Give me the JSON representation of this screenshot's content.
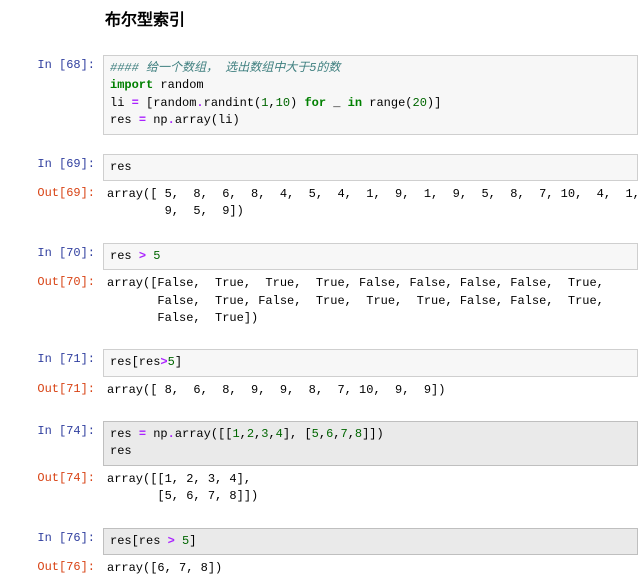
{
  "heading": "布尔型索引",
  "cells": [
    {
      "prompt": "In [68]:",
      "ptype": "in",
      "kind": "code",
      "tokens": [
        {
          "t": "#### 给一个数组， 选出数组中大于5的数",
          "c": "c-comment"
        },
        {
          "t": "\n"
        },
        {
          "t": "import",
          "c": "c-keyword"
        },
        {
          "t": " random\n"
        },
        {
          "t": "li "
        },
        {
          "t": "=",
          "c": "c-op"
        },
        {
          "t": " [random"
        },
        {
          "t": ".",
          "c": "c-op"
        },
        {
          "t": "randint("
        },
        {
          "t": "1",
          "c": "c-num"
        },
        {
          "t": ","
        },
        {
          "t": "10",
          "c": "c-num"
        },
        {
          "t": ") "
        },
        {
          "t": "for",
          "c": "c-keyword"
        },
        {
          "t": " _ "
        },
        {
          "t": "in",
          "c": "c-keyword"
        },
        {
          "t": " range("
        },
        {
          "t": "20",
          "c": "c-num"
        },
        {
          "t": ")]\n"
        },
        {
          "t": "res "
        },
        {
          "t": "=",
          "c": "c-op"
        },
        {
          "t": " np"
        },
        {
          "t": ".",
          "c": "c-op"
        },
        {
          "t": "array(li)"
        }
      ]
    },
    {
      "prompt": "In [69]:",
      "ptype": "in",
      "kind": "code",
      "tokens": [
        {
          "t": "res"
        }
      ]
    },
    {
      "prompt": "Out[69]:",
      "ptype": "out",
      "kind": "plain",
      "tokens": [
        {
          "t": "array([ 5,  8,  6,  8,  4,  5,  4,  1,  9,  1,  9,  5,  8,  7, 10,  4,  1,\n"
        },
        {
          "t": "        9,  5,  9])"
        }
      ]
    },
    {
      "prompt": "In [70]:",
      "ptype": "in",
      "kind": "code",
      "tokens": [
        {
          "t": "res "
        },
        {
          "t": ">",
          "c": "c-op"
        },
        {
          "t": " "
        },
        {
          "t": "5",
          "c": "c-num"
        }
      ]
    },
    {
      "prompt": "Out[70]:",
      "ptype": "out",
      "kind": "plain",
      "tokens": [
        {
          "t": "array([False,  True,  True,  True, False, False, False, False,  True,\n"
        },
        {
          "t": "       False,  True, False,  True,  True,  True, False, False,  True,\n"
        },
        {
          "t": "       False,  True])"
        }
      ]
    },
    {
      "prompt": "In [71]:",
      "ptype": "in",
      "kind": "code",
      "tokens": [
        {
          "t": "res[res"
        },
        {
          "t": ">",
          "c": "c-op"
        },
        {
          "t": "5",
          "c": "c-num"
        },
        {
          "t": "]"
        }
      ]
    },
    {
      "prompt": "Out[71]:",
      "ptype": "out",
      "kind": "plain",
      "tokens": [
        {
          "t": "array([ 8,  6,  8,  9,  9,  8,  7, 10,  9,  9])"
        }
      ]
    },
    {
      "prompt": "In [74]:",
      "ptype": "in",
      "kind": "code",
      "selected": true,
      "tokens": [
        {
          "t": "res "
        },
        {
          "t": "=",
          "c": "c-op"
        },
        {
          "t": " np"
        },
        {
          "t": ".",
          "c": "c-op"
        },
        {
          "t": "array([["
        },
        {
          "t": "1",
          "c": "c-num"
        },
        {
          "t": ","
        },
        {
          "t": "2",
          "c": "c-num"
        },
        {
          "t": ","
        },
        {
          "t": "3",
          "c": "c-num"
        },
        {
          "t": ","
        },
        {
          "t": "4",
          "c": "c-num"
        },
        {
          "t": "], ["
        },
        {
          "t": "5",
          "c": "c-num"
        },
        {
          "t": ","
        },
        {
          "t": "6",
          "c": "c-num"
        },
        {
          "t": ","
        },
        {
          "t": "7",
          "c": "c-num"
        },
        {
          "t": ","
        },
        {
          "t": "8",
          "c": "c-num"
        },
        {
          "t": "]])\n"
        },
        {
          "t": "res"
        }
      ]
    },
    {
      "prompt": "Out[74]:",
      "ptype": "out",
      "kind": "plain",
      "tokens": [
        {
          "t": "array([[1, 2, 3, 4],\n"
        },
        {
          "t": "       [5, 6, 7, 8]])"
        }
      ]
    },
    {
      "prompt": "In [76]:",
      "ptype": "in",
      "kind": "code",
      "selected": true,
      "tokens": [
        {
          "t": "res[res "
        },
        {
          "t": ">",
          "c": "c-op"
        },
        {
          "t": " "
        },
        {
          "t": "5",
          "c": "c-num"
        },
        {
          "t": "]"
        }
      ]
    },
    {
      "prompt": "Out[76]:",
      "ptype": "out",
      "kind": "plain",
      "tokens": [
        {
          "t": "array([6, 7, 8])"
        }
      ]
    }
  ]
}
